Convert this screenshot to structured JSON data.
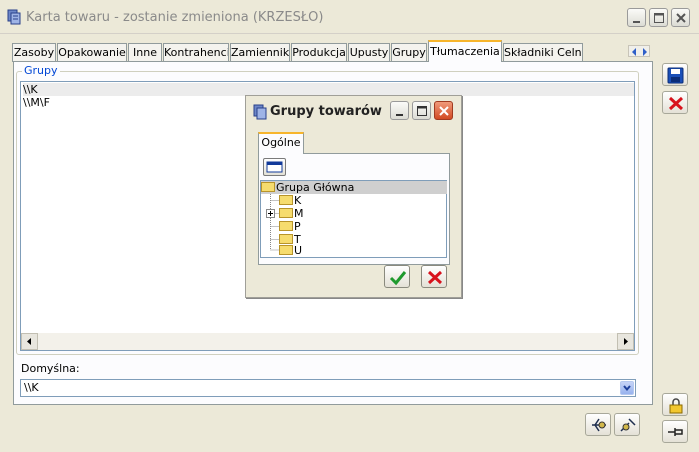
{
  "window": {
    "title": "Karta towaru - zostanie zmieniona (KRZESŁO)"
  },
  "tabs": [
    {
      "label": "Zasoby"
    },
    {
      "label": "Opakowanie"
    },
    {
      "label": "Inne"
    },
    {
      "label": "Kontrahenci"
    },
    {
      "label": "Zamienniki"
    },
    {
      "label": "Produkcja"
    },
    {
      "label": "Upusty"
    },
    {
      "label": "Grupy"
    },
    {
      "label": "Tłumaczenia",
      "active": true
    },
    {
      "label": "Składniki Celne"
    }
  ],
  "groups": {
    "legend": "Grupy",
    "rows": [
      "\\\\K",
      "\\\\M\\F"
    ]
  },
  "default_group": {
    "label": "Domyślna:",
    "value": "\\\\K"
  },
  "dialog": {
    "title": "Grupy towarów",
    "tab": "Ogólne",
    "tree": {
      "root": "Grupa Główna",
      "children": [
        {
          "label": "K",
          "expandable": false
        },
        {
          "label": "M",
          "expandable": true
        },
        {
          "label": "P",
          "expandable": false
        },
        {
          "label": "T",
          "expandable": false
        },
        {
          "label": "U",
          "expandable": false
        }
      ]
    }
  },
  "icons": {
    "save": "save-icon",
    "cancel": "close-icon",
    "confirm": "check-icon",
    "lock": "lock-icon",
    "pin": "pin-icon"
  },
  "colors": {
    "active_tab_accent": "#f7b52c",
    "legend_text": "#0046d5",
    "cancel_red": "#d8121c",
    "confirm_green": "#1f9a2e"
  }
}
